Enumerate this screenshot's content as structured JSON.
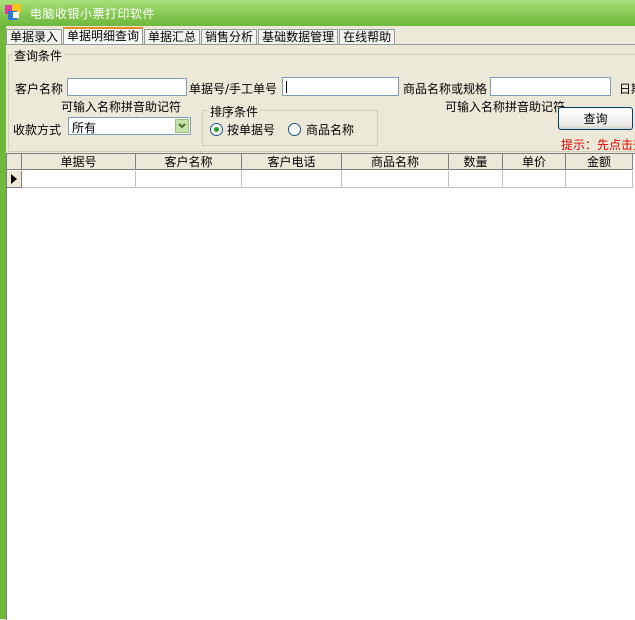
{
  "window": {
    "title": "电脑收银小票打印软件"
  },
  "tabs": [
    {
      "label": "单据录入",
      "active": false
    },
    {
      "label": "单据明细查询",
      "active": true
    },
    {
      "label": "单据汇总",
      "active": false
    },
    {
      "label": "销售分析",
      "active": false
    },
    {
      "label": "基础数据管理",
      "active": false
    },
    {
      "label": "在线帮助",
      "active": false
    }
  ],
  "query": {
    "group_title": "查询条件",
    "customer_label": "客户名称",
    "customer_value": "",
    "customer_hint": "可输入名称拼音助记符",
    "doc_label": "单据号/手工单号",
    "doc_value": "",
    "product_label": "商品名称或规格",
    "product_value": "",
    "product_hint": "可输入名称拼音助记符",
    "date_label": "日期",
    "payment_label": "收款方式",
    "payment_value": "所有",
    "sort_title": "排序条件",
    "sort_options": [
      {
        "label": "按单据号",
        "selected": true
      },
      {
        "label": "商品名称",
        "selected": false
      }
    ],
    "query_button": "查询",
    "hint_text": "提示：先点击查询"
  },
  "grid": {
    "columns": [
      "单据号",
      "客户名称",
      "客户电话",
      "商品名称",
      "数量",
      "单价",
      "金额"
    ],
    "rows": []
  },
  "colors": {
    "titlebar": "#82c750",
    "accent_tab": "#e68b2c",
    "hint": "#e00000",
    "radio_selected": "#21a121"
  }
}
